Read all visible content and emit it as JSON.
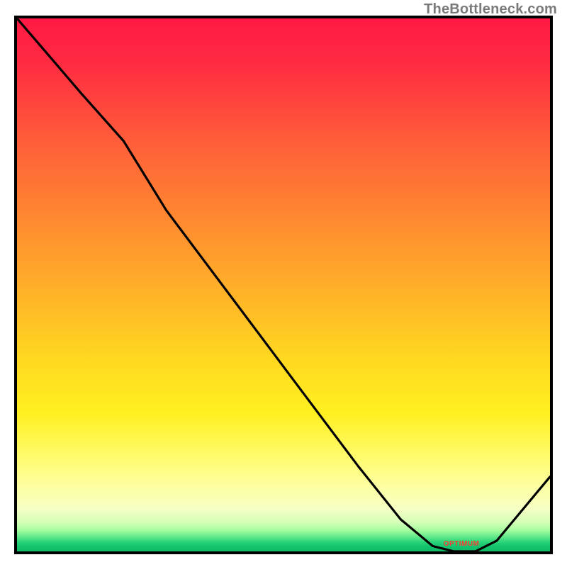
{
  "attribution": "TheBottleneck.com",
  "valley_label": "OPTIMUM",
  "chart_data": {
    "type": "line",
    "title": "",
    "xlabel": "",
    "ylabel": "",
    "xlim": [
      0,
      100
    ],
    "ylim": [
      0,
      100
    ],
    "series": [
      {
        "name": "bottleneck-curve",
        "x": [
          0,
          6,
          12,
          20,
          28,
          40,
          52,
          64,
          72,
          78,
          82,
          86,
          90,
          100
        ],
        "y": [
          100,
          93,
          86,
          77,
          64,
          48,
          32,
          16,
          6,
          1,
          0,
          0,
          2,
          14
        ]
      }
    ],
    "annotations": [
      {
        "text": "OPTIMUM",
        "x": 84,
        "y": 0.5
      }
    ],
    "background_gradient": {
      "top": "#ff1a45",
      "mid": "#fff020",
      "bottom": "#0fba66"
    }
  }
}
